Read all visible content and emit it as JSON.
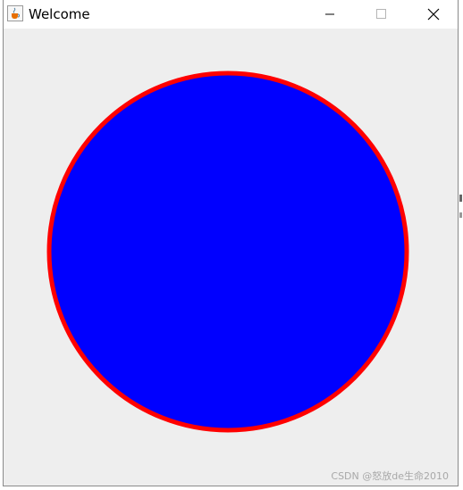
{
  "window": {
    "title": "Welcome",
    "app_icon": "java-cup-icon",
    "controls": {
      "minimize_icon": "minimize-icon",
      "maximize_icon": "maximize-icon",
      "close_icon": "close-icon"
    }
  },
  "canvas": {
    "background_color": "#eeeeee",
    "shape": {
      "type": "circle",
      "fill_color": "#0000ff",
      "stroke_color": "#ff0000"
    }
  },
  "watermark": {
    "text": "CSDN @怒放de生命2010"
  }
}
